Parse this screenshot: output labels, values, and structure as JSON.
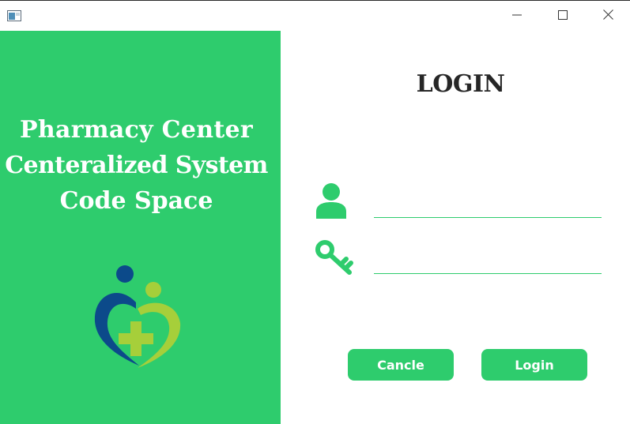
{
  "window": {
    "controls": {
      "minimize_icon": "minimize-icon",
      "maximize_icon": "maximize-icon",
      "close_icon": "close-icon"
    }
  },
  "brand": {
    "line1": "Pharmacy Center",
    "line2": "Centeralized System",
    "line3": "Code Space"
  },
  "login": {
    "title": "LOGIN",
    "username": {
      "value": "",
      "placeholder": ""
    },
    "password": {
      "value": "",
      "placeholder": ""
    },
    "cancel_label": "Cancle",
    "login_label": "Login"
  },
  "colors": {
    "accent": "#2ecc6d",
    "logo_blue": "#0c4a8a",
    "logo_lime": "#a6cf3a",
    "title_text": "#262626"
  }
}
